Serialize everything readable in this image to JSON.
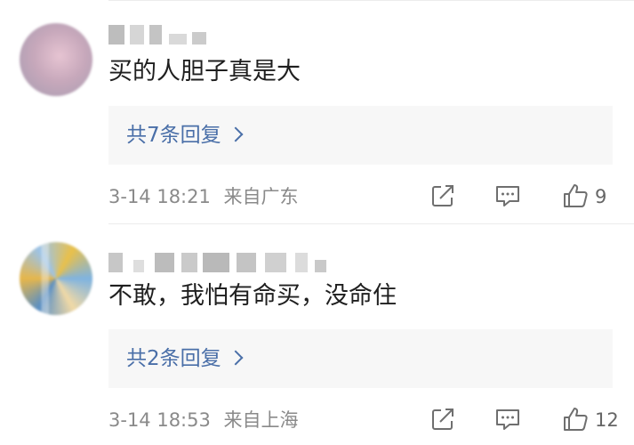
{
  "comments": [
    {
      "text": "买的人胆子真是大",
      "reply_link": "共7条回复",
      "date": "3-14 18:21",
      "location": "来自广东",
      "likes": "9"
    },
    {
      "text": "不敢，我怕有命买，没命住",
      "reply_link": "共2条回复",
      "date": "3-14 18:53",
      "location": "来自上海",
      "likes": "12"
    }
  ],
  "icons": {
    "share": "share-icon",
    "reply": "comment-icon",
    "like": "thumbs-up-icon"
  },
  "colors": {
    "link": "#4a6fa8",
    "meta": "#8a8a8a",
    "reply_box": "#f7f7f7"
  }
}
